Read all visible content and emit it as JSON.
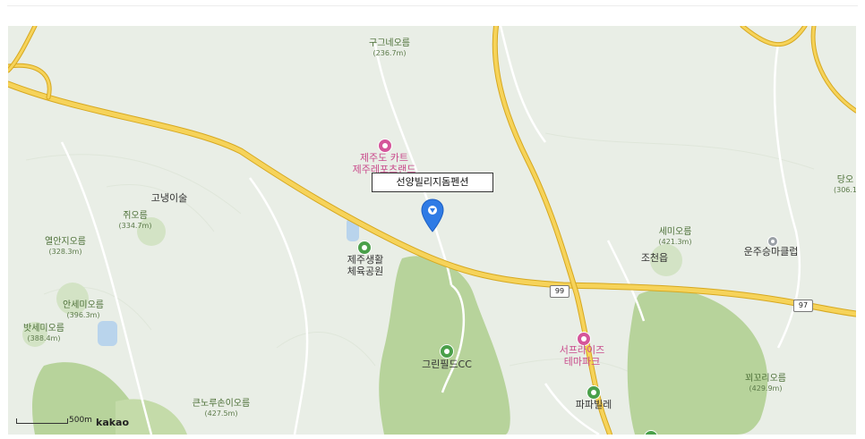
{
  "map": {
    "info_label": "선양빌리지돔펜션",
    "peaks": [
      {
        "name": "구그네오름",
        "elev": "(236.7m)"
      },
      {
        "name": "쥐오름",
        "elev": "(334.7m)"
      },
      {
        "name": "열안지오름",
        "elev": "(328.3m)"
      },
      {
        "name": "안세미오름",
        "elev": "(396.3m)"
      },
      {
        "name": "밧세미오름",
        "elev": "(388.4m)"
      },
      {
        "name": "큰노루손이오름",
        "elev": "(427.5m)"
      },
      {
        "name": "세미오름",
        "elev": "(421.3m)"
      },
      {
        "name": "꾀꼬리오름",
        "elev": "(429.9m)"
      },
      {
        "name": "당오",
        "elev": "(306.1"
      }
    ],
    "places": {
      "goraeng": "고냉이술",
      "jocheon": "조천읍"
    },
    "pois": {
      "kart": "제주도 카트\n제주레포츠랜드",
      "sports_park": "제주생활\n체육공원",
      "greenfield": "그린필드CC",
      "surprise": "서프라이즈\n테마파크",
      "papaville": "파파빌레",
      "horse_club": "운주승마클럽"
    },
    "road_shields": [
      "99",
      "97"
    ],
    "scale_text": "500m",
    "logo_text": "kakao",
    "colors": {
      "background": "#e9eee6",
      "golf_green": "#b7d39b",
      "road_yellow": "#f2c94c",
      "road_outline": "#d6a820",
      "minor_road": "#ffffff",
      "marker_blue": "#2f7be5",
      "pink_poi": "#d5559a",
      "green_poi": "#4aa04a"
    }
  }
}
